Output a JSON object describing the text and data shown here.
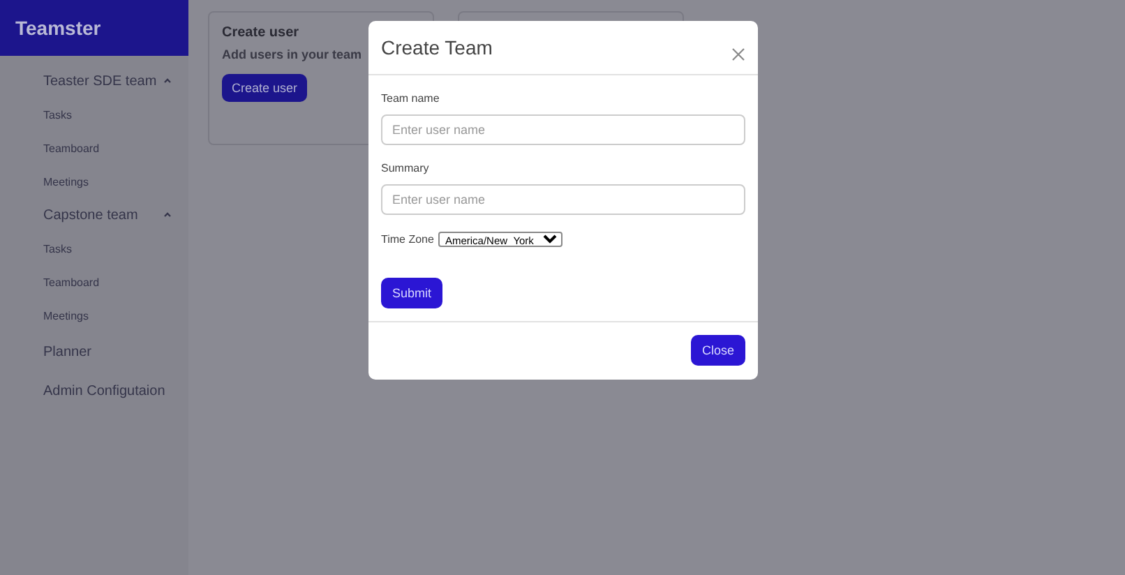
{
  "sidebar": {
    "brand": "Teamster",
    "items": [
      {
        "kind": "group",
        "label": "Teaster SDE team",
        "expanded": true,
        "children": [
          {
            "label": "Tasks"
          },
          {
            "label": "Teamboard"
          },
          {
            "label": "Meetings"
          }
        ]
      },
      {
        "kind": "group",
        "label": "Capstone team",
        "expanded": true,
        "children": [
          {
            "label": "Tasks"
          },
          {
            "label": "Teamboard"
          },
          {
            "label": "Meetings"
          }
        ]
      },
      {
        "kind": "link",
        "label": "Planner"
      },
      {
        "kind": "link",
        "label": "Admin Configutaion"
      }
    ]
  },
  "cards": [
    {
      "kind": "action",
      "title": "Create user",
      "subtitle": "Add users in your team",
      "button": "Create user"
    },
    {
      "kind": "blank"
    }
  ],
  "modal": {
    "title": "Create Team",
    "fields": [
      {
        "label": "Team name",
        "placeholder": "Enter user name"
      },
      {
        "label": "Summary",
        "placeholder": "Enter user name"
      }
    ],
    "time_zone": {
      "label": "Time Zone",
      "value": "America/New_York"
    },
    "submit": "Submit",
    "close": "Close"
  }
}
